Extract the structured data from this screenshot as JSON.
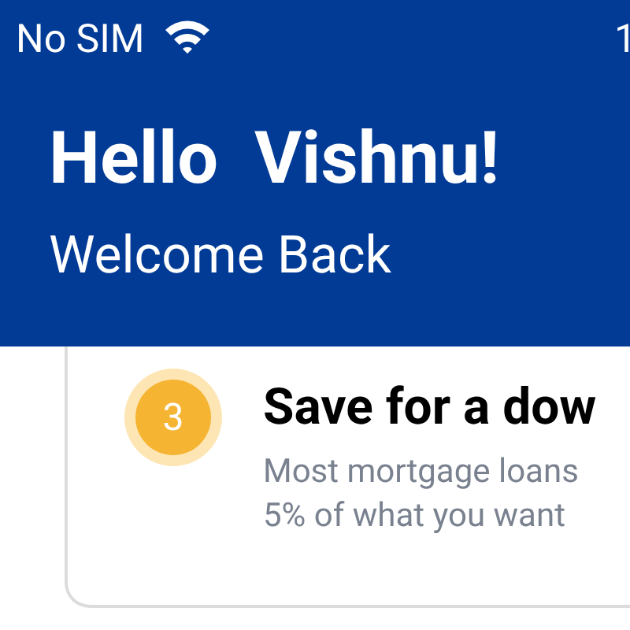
{
  "status_bar": {
    "carrier": "No SIM",
    "time": "1"
  },
  "header": {
    "greeting": "Hello  Vishnu!",
    "subtitle": "Welcome Back"
  },
  "step": {
    "number": "3",
    "title": "Save for a dow",
    "description_lines": [
      "Most mortgage loans",
      "5% of what you want"
    ]
  }
}
